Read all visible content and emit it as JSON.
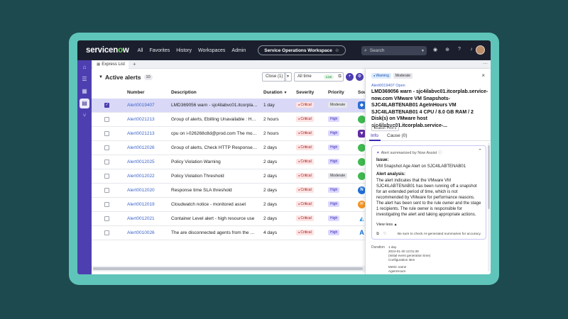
{
  "brand": "servicenow",
  "nav": [
    "All",
    "Favorites",
    "History",
    "Workspaces",
    "Admin"
  ],
  "workspace_pill": "Service Operations Workspace",
  "search": {
    "placeholder": "Search"
  },
  "tab": {
    "label": "Express List"
  },
  "list": {
    "title": "Active alerts",
    "count": "10",
    "close_btn": "Close (1)",
    "time_filter": "All time",
    "live_label": "Live",
    "columns": [
      "Number",
      "Description",
      "Duration",
      "Severity",
      "Priority",
      "Sour"
    ],
    "rows": [
      {
        "number": "Alert0019407",
        "description": "LMD369056 warn - sjc4ilabvc01.itcorplab.s...",
        "duration": "1 day",
        "severity": "Critical",
        "priority": "Moderate",
        "src": "vmware",
        "selected": true
      },
      {
        "number": "Alert0021213",
        "description": "Group of alerts, Ebilling Unavailable : HTTP ...",
        "duration": "2 hours",
        "severity": "Critical",
        "priority": "High",
        "src": "green"
      },
      {
        "number": "Alert0021213",
        "description": "cpu on i-026268c8d@prod.com The monitor...",
        "duration": "2 hours",
        "severity": "Critical",
        "priority": "High",
        "src": "purple"
      },
      {
        "number": "Alert0012026",
        "description": "Group of alerts, Check HTTP Response CRIT...",
        "duration": "2 days",
        "severity": "Critical",
        "priority": "High",
        "src": "green"
      },
      {
        "number": "Alert0012025",
        "description": "Policy Violation Warning",
        "duration": "2 days",
        "severity": "Critical",
        "priority": "High",
        "src": "green"
      },
      {
        "number": "Alert0012022",
        "description": "Policy Violation Threshold",
        "duration": "2 days",
        "severity": "Critical",
        "priority": "Moderate",
        "src": "green"
      },
      {
        "number": "Alert0012020",
        "description": "Response time SLA threshold",
        "duration": "2 days",
        "severity": "Critical",
        "priority": "High",
        "src": "blue-n"
      },
      {
        "number": "Alert0012019",
        "description": "Cloudwatch notice - monitored asset",
        "duration": "2 days",
        "severity": "Critical",
        "priority": "High",
        "src": "orange"
      },
      {
        "number": "Alert0012021",
        "description": "Container Level alert - high resource use",
        "duration": "2 days",
        "severity": "Critical",
        "priority": "High",
        "src": "docker"
      },
      {
        "number": "Alert0010026",
        "description": "The are disconnected agents from the MID I...",
        "duration": "4 days",
        "severity": "Critical",
        "priority": "High",
        "src": "azure"
      }
    ]
  },
  "detail": {
    "badge_warning": "Warning",
    "badge_priority": "Moderate",
    "subtitle": "Alert0019407 Open",
    "title": "LMD369056 warn - sjc4ilabvc01.itcorplab.service-now.com VMware VM Snapshots-SJC4ILABTENAB01 AgeInHours VM SJC4ILABTENAB01 4 CPU / 8.0 GB RAM / 2 Disk(s) on VMware host sjc4ilabvc01.itcorplab.service-...",
    "location": "location: PHX-1",
    "tabs": [
      "Info",
      "Cause (0)"
    ],
    "assist": {
      "header": "Alert summarized by Now Assist",
      "issue_label": "Issue:",
      "issue_text": "VM Snapshot Age Alert on SJC4ILABTENAB01",
      "analysis_label": "Alert analysis:",
      "analysis_text": "The alert indicates that the VMware VM SJC4ILABTENAB01 has been running off a snapshot for an extended period of time, which is not recommended by VMware for performance reasons. The alert has been sent to the rule owner and the stage 1 recipients. The rule owner is responsible for investigating the alert and taking appropriate actions.",
      "view_less": "View less",
      "disclaimer": "Be sure to check AI-generated summaries for accuracy."
    },
    "field_label": "Duration",
    "field_values": [
      "1 day",
      "2024-01-30 12:01:39",
      "(Initial event generation time)",
      "Configuration item",
      "",
      "Metric name",
      "AgeInHours"
    ]
  }
}
